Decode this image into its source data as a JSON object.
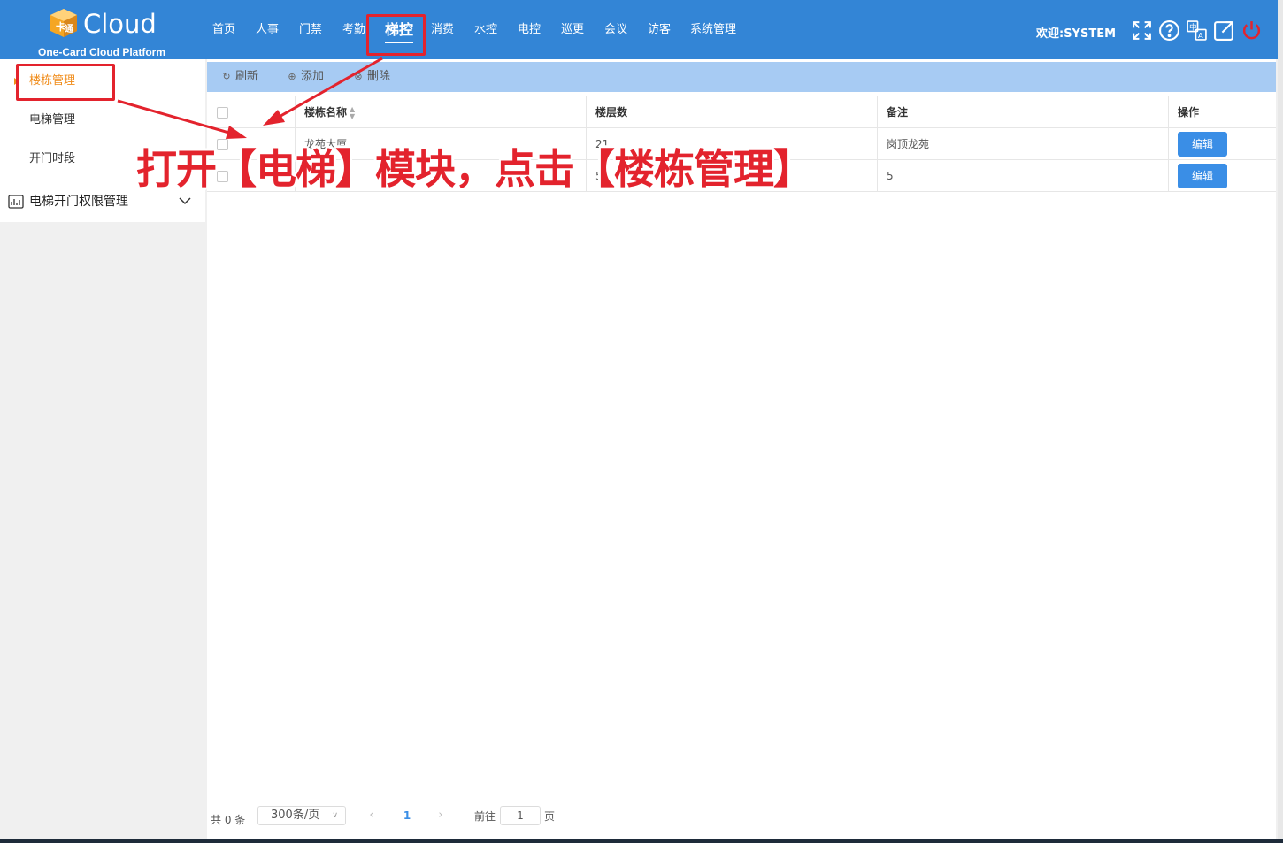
{
  "header": {
    "logo_text": "Cloud",
    "logo_subtitle": "One-Card Cloud Platform",
    "nav": [
      "首页",
      "人事",
      "门禁",
      "考勤",
      "梯控",
      "消费",
      "水控",
      "电控",
      "巡更",
      "会议",
      "访客",
      "系统管理"
    ],
    "active_nav": "梯控",
    "welcome": "欢迎:SYSTEM",
    "icons": [
      "fullscreen-icon",
      "help-icon",
      "translate-icon",
      "external-link-icon",
      "power-icon"
    ],
    "colors": {
      "bar": "#3385d6",
      "text": "#ffffff"
    }
  },
  "sidebar": {
    "items": [
      {
        "label": "楼栋管理",
        "active": true
      },
      {
        "label": "电梯管理",
        "active": false
      },
      {
        "label": "开门时段",
        "active": false
      }
    ],
    "group": {
      "label": "电梯开门权限管理",
      "icon": "chart-icon",
      "expanded": false
    },
    "active_color": "#f08c1a"
  },
  "toolbar": {
    "refresh": "刷新",
    "add": "添加",
    "delete": "删除"
  },
  "table": {
    "columns": [
      "楼栋名称",
      "楼层数",
      "备注",
      "操作"
    ],
    "rows": [
      {
        "name": "龙苑大厦",
        "floors": "21",
        "remark": "岗顶龙苑",
        "action": "编辑"
      },
      {
        "name": "",
        "floors": "5",
        "remark": "5",
        "action": "编辑"
      }
    ]
  },
  "pagination": {
    "total": "共 0 条",
    "page_size": "300条/页",
    "current_page": "1",
    "goto_label": "前往",
    "goto_value": "1",
    "page_suffix": "页"
  },
  "annotation": {
    "text": "打开【电梯】模块，点击【楼栋管理】",
    "color": "#e3232d"
  }
}
